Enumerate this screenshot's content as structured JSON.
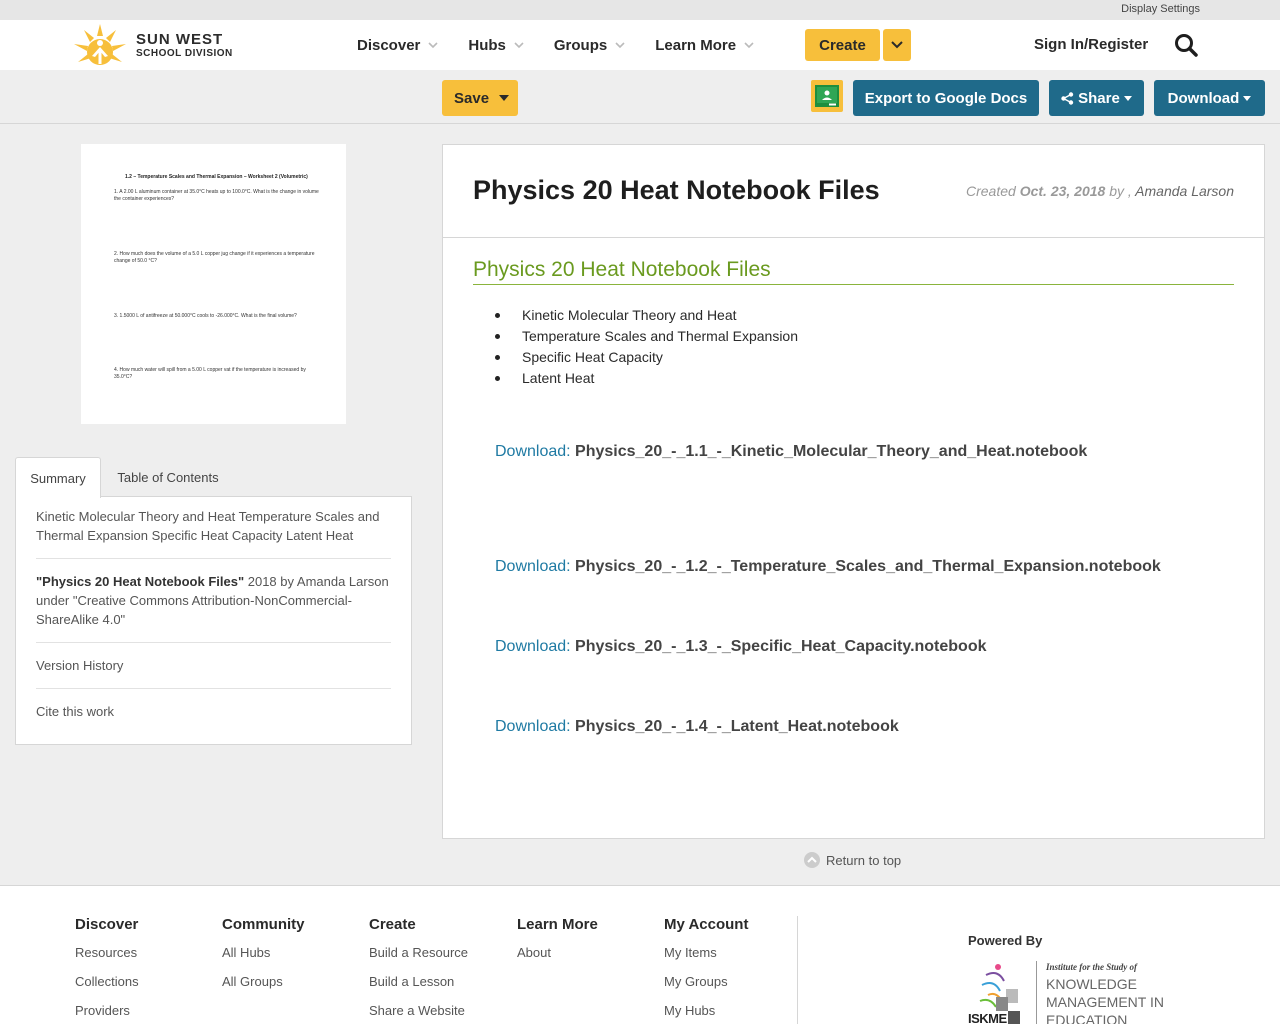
{
  "util": {
    "display_settings": "Display Settings"
  },
  "brand": {
    "line1": "SUN WEST",
    "line2": "SCHOOL DIVISION"
  },
  "nav": {
    "items": [
      {
        "label": "Discover"
      },
      {
        "label": "Hubs"
      },
      {
        "label": "Groups"
      },
      {
        "label": "Learn More"
      }
    ],
    "create_label": "Create",
    "signin_label": "Sign In/Register"
  },
  "toolbar": {
    "save_label": "Save",
    "export_label": "Export to Google Docs",
    "share_label": "Share",
    "download_label": "Download"
  },
  "thumbnail": {
    "title": "1.2 – Temperature Scales and Thermal Expansion – Worksheet 2 (Volumetric)",
    "questions": [
      "1.  A 2.00 L aluminum container at 35.0°C heats up to 100.0°C.  What is the change in volume the container experiences?",
      "2.  How much does the volume of a 5.0 L copper jug change if it experiences a temperature change of 50.0 °C?",
      "3.  1.5000 L of antifreeze at 50.000°C cools to -26.000°C.  What is the final volume?",
      "4.  How much water will spill from a 5.00 L copper vat if the temperature is increased by 35.0°C?"
    ]
  },
  "sidebar": {
    "tabs": [
      {
        "label": "Summary"
      },
      {
        "label": "Table of Contents"
      }
    ],
    "summary_text": "Kinetic Molecular Theory and Heat Temperature Scales and Thermal Expansion Specific Heat Capacity Latent Heat",
    "attribution_title": "\"Physics 20 Heat Notebook Files\"",
    "attribution_rest": " 2018 by Amanda Larson under \"Creative Commons Attribution-NonCommercial-ShareAlike 4.0\"",
    "version_history": "Version History",
    "cite": "Cite this work"
  },
  "resource": {
    "title": "Physics 20 Heat Notebook Files",
    "created_prefix": "Created ",
    "created_date": "Oct. 23, 2018",
    "created_by": " by , ",
    "author": "Amanda Larson",
    "section_title": "Physics 20 Heat Notebook Files",
    "topics": [
      "Kinetic Molecular Theory and Heat",
      "Temperature Scales and Thermal Expansion",
      "Specific Heat Capacity",
      "Latent Heat"
    ],
    "download_prefix": "Download: ",
    "files": [
      "Physics_20_-_1.1_-_Kinetic_Molecular_Theory_and_Heat.notebook",
      "Physics_20_-_1.2_-_Temperature_Scales_and_Thermal_Expansion.notebook",
      "Physics_20_-_1.3_-_Specific_Heat_Capacity.notebook",
      "Physics_20_-_1.4_-_Latent_Heat.notebook"
    ],
    "return_to_top": "Return to top"
  },
  "footer": {
    "columns": [
      {
        "heading": "Discover",
        "links": [
          "Resources",
          "Collections",
          "Providers"
        ]
      },
      {
        "heading": "Community",
        "links": [
          "All Hubs",
          "All Groups"
        ]
      },
      {
        "heading": "Create",
        "links": [
          "Build a Resource",
          "Build a Lesson",
          "Share a Website"
        ]
      },
      {
        "heading": "Learn More",
        "links": [
          "About"
        ]
      },
      {
        "heading": "My Account",
        "links": [
          "My Items",
          "My Groups",
          "My Hubs"
        ]
      }
    ],
    "powered_by": "Powered By",
    "iskme": {
      "tagline": "Institute for the Study of",
      "line1": "KNOWLEDGE",
      "line2": "MANAGEMENT IN",
      "line3": "EDUCATION",
      "mark": "ISKME"
    }
  },
  "colors": {
    "accent": "#f7bf3b",
    "primary": "#1f6a8a",
    "section_green": "#6a9a1f",
    "link_blue": "#1f7aa3"
  }
}
